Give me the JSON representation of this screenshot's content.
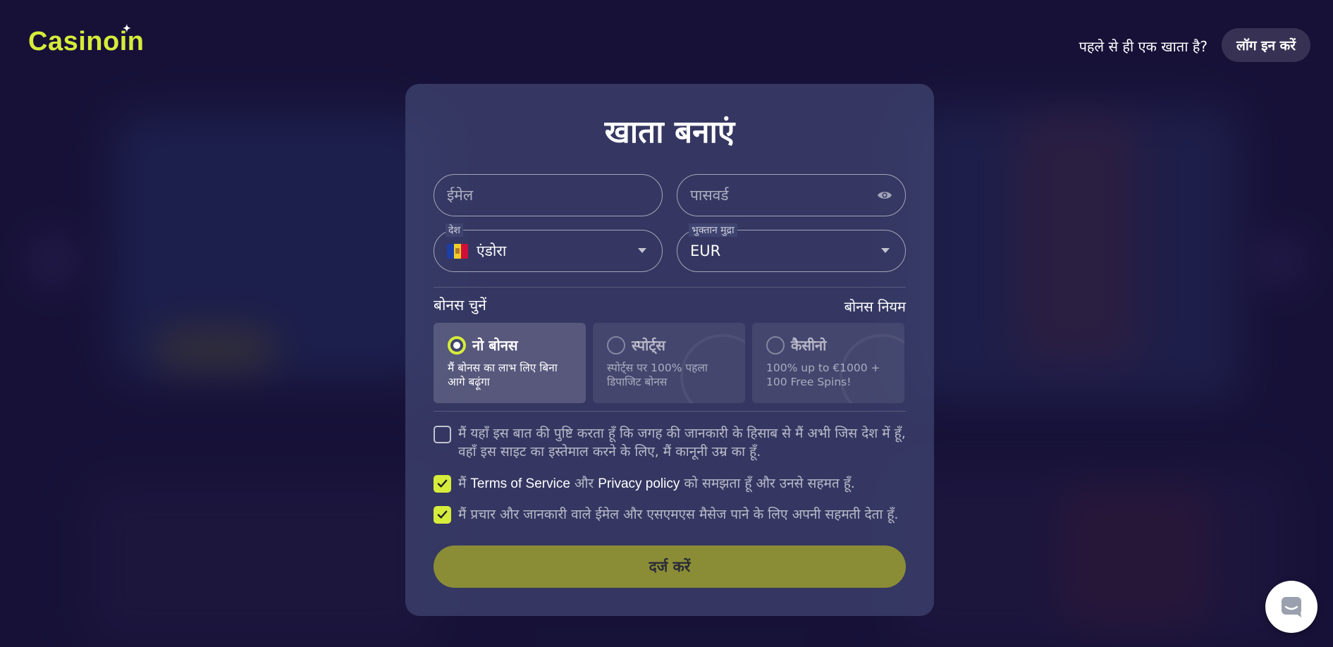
{
  "header": {
    "logo_text": "Casinoin",
    "have_account_text": "पहले से ही एक खाता है?",
    "login_label": "लॉग इन करें"
  },
  "form": {
    "title": "खाता बनाएं",
    "email_placeholder": "ईमेल",
    "password_placeholder": "पासवर्ड",
    "country_label": "देश",
    "country_value": "एंडोरा",
    "currency_label": "भुक्तान मुद्रा",
    "currency_value": "EUR"
  },
  "bonus": {
    "heading": "बोनस चुनें",
    "rules_link": "बोनस नियम",
    "options": [
      {
        "title": "नो बोनस",
        "desc": "मैं बोनस का लाभ लिए बिना आगे बढ़ूंगा",
        "selected": true
      },
      {
        "title": "स्पोर्ट्स",
        "desc": "स्पोर्ट्स पर 100% पहला डिपाजिट बोनस",
        "selected": false
      },
      {
        "title": "कैसीनो",
        "desc": "100% up to €1000 + 100 Free Spins!",
        "selected": false
      }
    ]
  },
  "consents": {
    "age": {
      "text": "मैं यहाँ इस बात की पुष्टि करता हूँ कि जगह की जानकारी के हिसाब से मैं अभी जिस देश में हूँ, वहाँ इस साइट का इस्तेमाल करने के लिए, मैं कानूनी उम्र का हूँ.",
      "checked": false
    },
    "tos": {
      "prefix": "मैं",
      "terms": "Terms of Service",
      "and": "और",
      "privacy": "Privacy policy",
      "suffix": "को समझता हूँ और उनसे सहमत हूँ.",
      "checked": true
    },
    "promo": {
      "text": "मैं प्रचार और जानकारी वाले ईमेल और एसएमएस मैसेज पाने के लिए अपनी सहमती देता हूँ.",
      "checked": true
    }
  },
  "submit_label": "दर्ज करें",
  "colors": {
    "accent": "#d6ec3a",
    "submit_bg": "#8a8d36",
    "card_bg": "#3e426e",
    "page_bg": "#1b1640"
  },
  "icons": {
    "password_toggle": "eye-icon",
    "select_caret": "caret-down-icon",
    "checkbox_mark": "checkmark-icon",
    "chat": "chat-icon",
    "country_flag": "andorra-flag-icon"
  }
}
